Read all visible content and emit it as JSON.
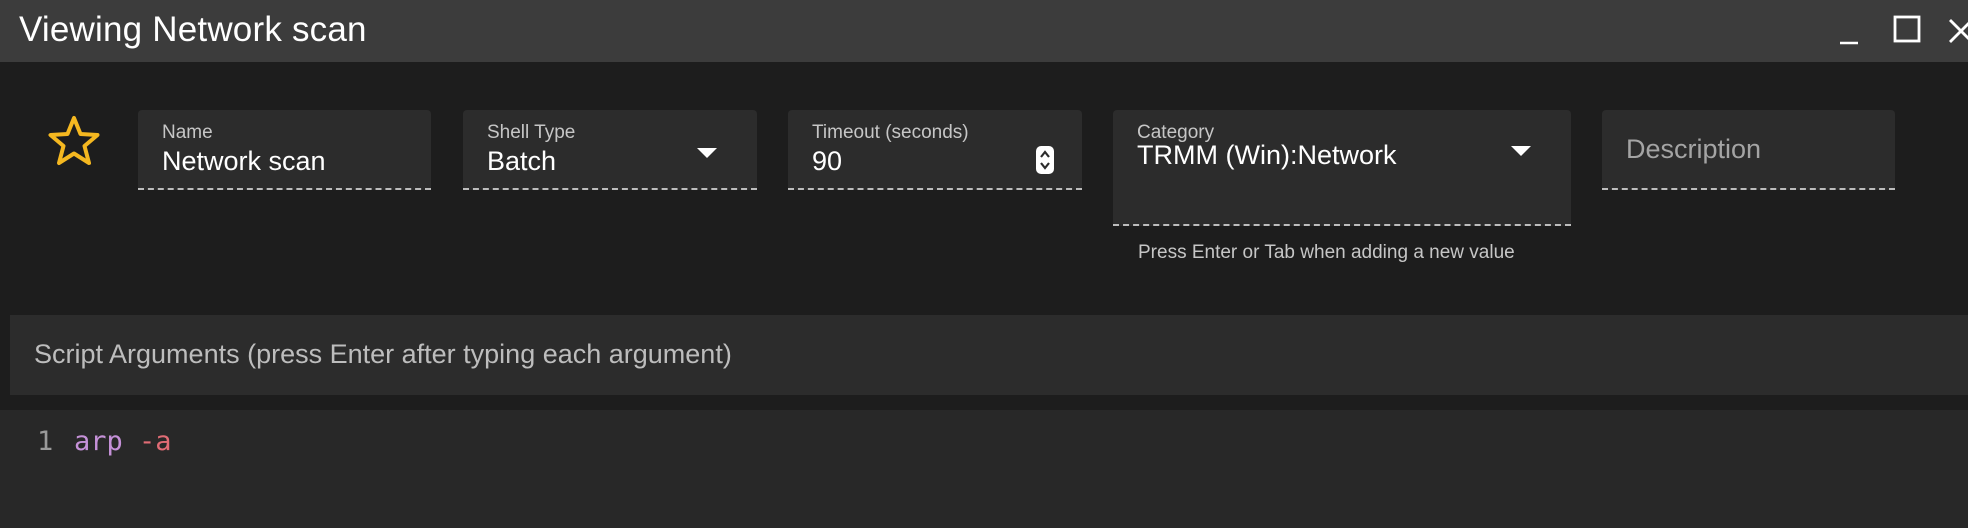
{
  "window": {
    "title": "Viewing Network scan",
    "controls": {
      "minimize": "minimize-icon",
      "maximize": "maximize-icon",
      "close": "close-icon"
    }
  },
  "favorite": {
    "icon": "star-outline-icon",
    "color": "#f5b820"
  },
  "fields": {
    "name": {
      "label": "Name",
      "value": "Network scan"
    },
    "shell_type": {
      "label": "Shell Type",
      "value": "Batch"
    },
    "timeout": {
      "label": "Timeout (seconds)",
      "value": "90"
    },
    "category": {
      "label": "Category",
      "value": "TRMM (Win):Network",
      "hint": "Press Enter or Tab when adding a new value"
    },
    "description": {
      "placeholder": "Description"
    }
  },
  "script_arguments": {
    "placeholder": "Script Arguments (press Enter after typing each argument)"
  },
  "editor": {
    "lines": [
      {
        "number": "1",
        "tokens": [
          {
            "text": "arp",
            "kind": "command"
          },
          {
            "text": " ",
            "kind": "space"
          },
          {
            "text": "-a",
            "kind": "flag"
          }
        ]
      }
    ]
  },
  "colors": {
    "titlebar": "#3c3c3c",
    "background": "#1d1d1d",
    "field": "#2c2c2c",
    "editor": "#282828",
    "command_token": "#c591d8",
    "flag_token": "#e06c75"
  }
}
